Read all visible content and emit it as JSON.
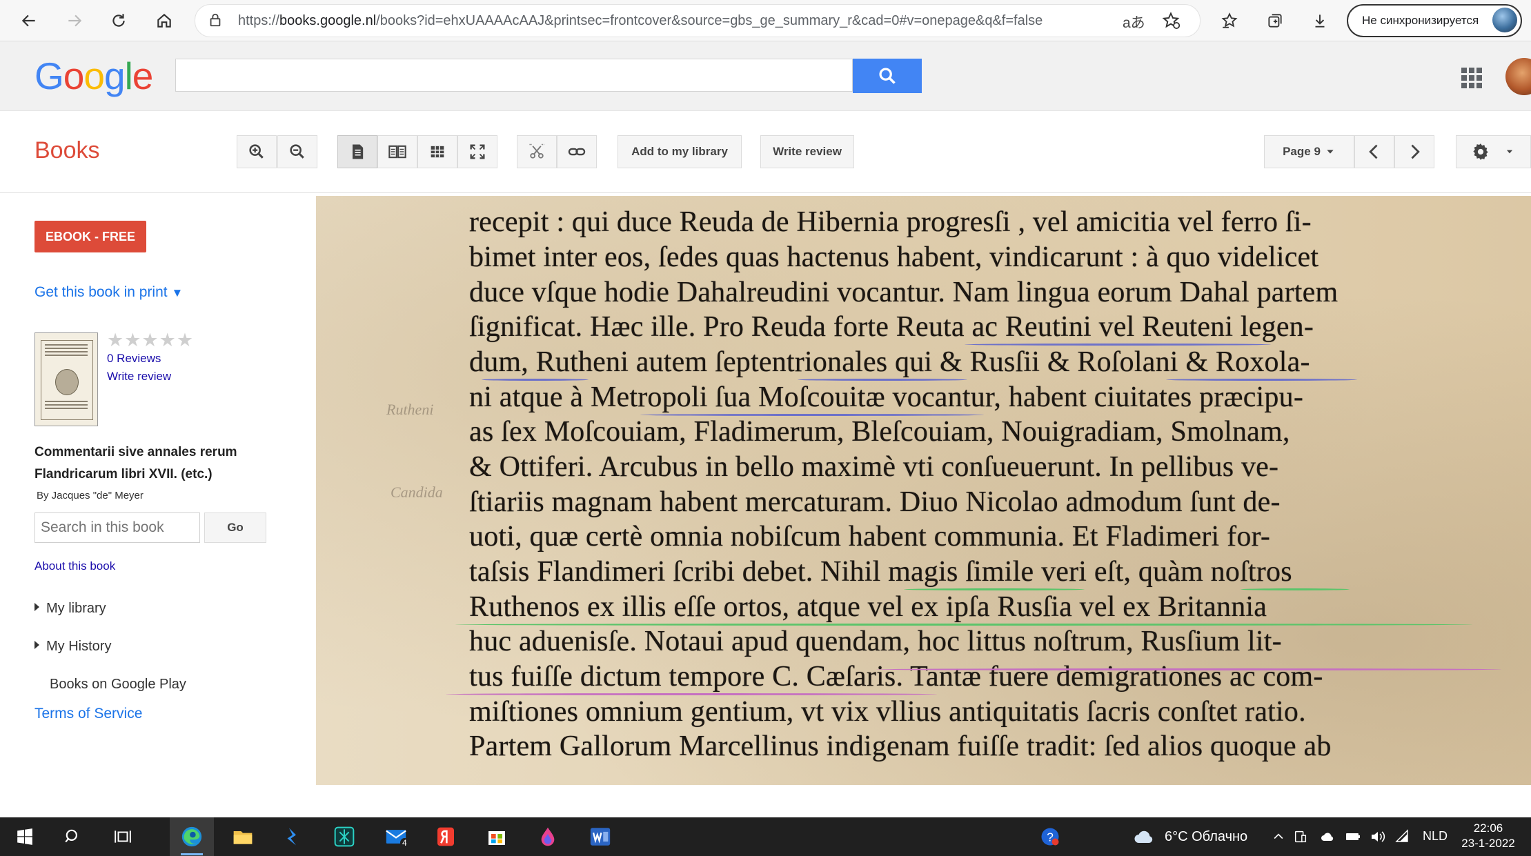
{
  "browser": {
    "url_prefix": "https://",
    "url_host": "books.google.nl",
    "url_path": "/books?id=ehxUAAAAcAAJ&printsec=frontcover&source=gbs_ge_summary_r&cad=0#v=onepage&q&f=false",
    "translate_glyph": "aあ",
    "sync_label": "Не синхронизируется"
  },
  "books_toolbar": {
    "section_title": "Books",
    "add_library_label": "Add to my library",
    "write_review_label": "Write review",
    "page_label": "Page 9"
  },
  "sidebar": {
    "ebook_label": "EBOOK - FREE",
    "get_print_label": "Get this book in print",
    "get_print_arrow": "▼",
    "stars": "★★★★★",
    "reviews_label": "0 Reviews",
    "write_review_label": "Write review",
    "book_title": "Commentarii sive annales rerum Flandricarum libri XVII. (etc.)",
    "author_label": "By Jacques \"de\" Meyer",
    "search_placeholder": "Search in this book",
    "go_label": "Go",
    "about_label": "About this book",
    "nav": [
      {
        "label": "My library"
      },
      {
        "label": "My History"
      },
      {
        "label": "Books on Google Play"
      }
    ],
    "terms_label": "Terms of Service"
  },
  "page_scan": {
    "lines": [
      "recepit : qui duce Reuda de Hibernia progresſi , vel amicitia vel ferro ſi-",
      "bimet inter eos, ſedes quas hactenus habent, vindicarunt : à quo videlicet",
      "duce vſque hodie Dahalreudini vocantur. Nam lingua eorum Dahal partem",
      "ſignificat. Hæc ille. Pro Reuda forte Reuta ac Reutini vel Reuteni legen-",
      "dum, Rutheni autem ſeptentrionales qui & Rusſii & Roſolani & Roxola-",
      "ni atque à Metropoli ſua Moſcouitæ vocantur, habent ciuitates præcipu-",
      "as ſex Moſcouiam, Fladimerum, Bleſcouiam, Nouigradiam, Smolnam,",
      "& Ottiferi. Arcubus in bello maximè vti conſueuerunt. In pellibus ve-",
      "ſtiariis magnam habent mercaturam. Diuo Nicolao admodum ſunt de-",
      "uoti, quæ certè omnia nobiſcum habent communia. Et Fladimeri for-",
      "taſsis Flandimeri ſcribi debet. Nihil magis ſimile veri eſt, quàm noſtros",
      "Ruthenos ex illis eſſe ortos, atque vel ex ipſa Rusſia vel ex Britannia",
      "huc aduenisſe. Notaui apud quendam, hoc littus noſtrum, Rusſium lit-",
      "tus fuiſſe dictum tempore C. Cæſaris. Tantæ fuere demigrationes ac com-",
      "miſtiones omnium gentium, vt vix vllius antiquitatis ſacris conſtet ratio.",
      "Partem Gallorum Marcellinus indigenam fuiſſe tradit: ſed alios quoque ab"
    ]
  },
  "taskbar": {
    "weather_label": "6°C Облачно",
    "language": "NLD",
    "time": "22:06",
    "date": "23-1-2022",
    "mail_badge": "4"
  }
}
